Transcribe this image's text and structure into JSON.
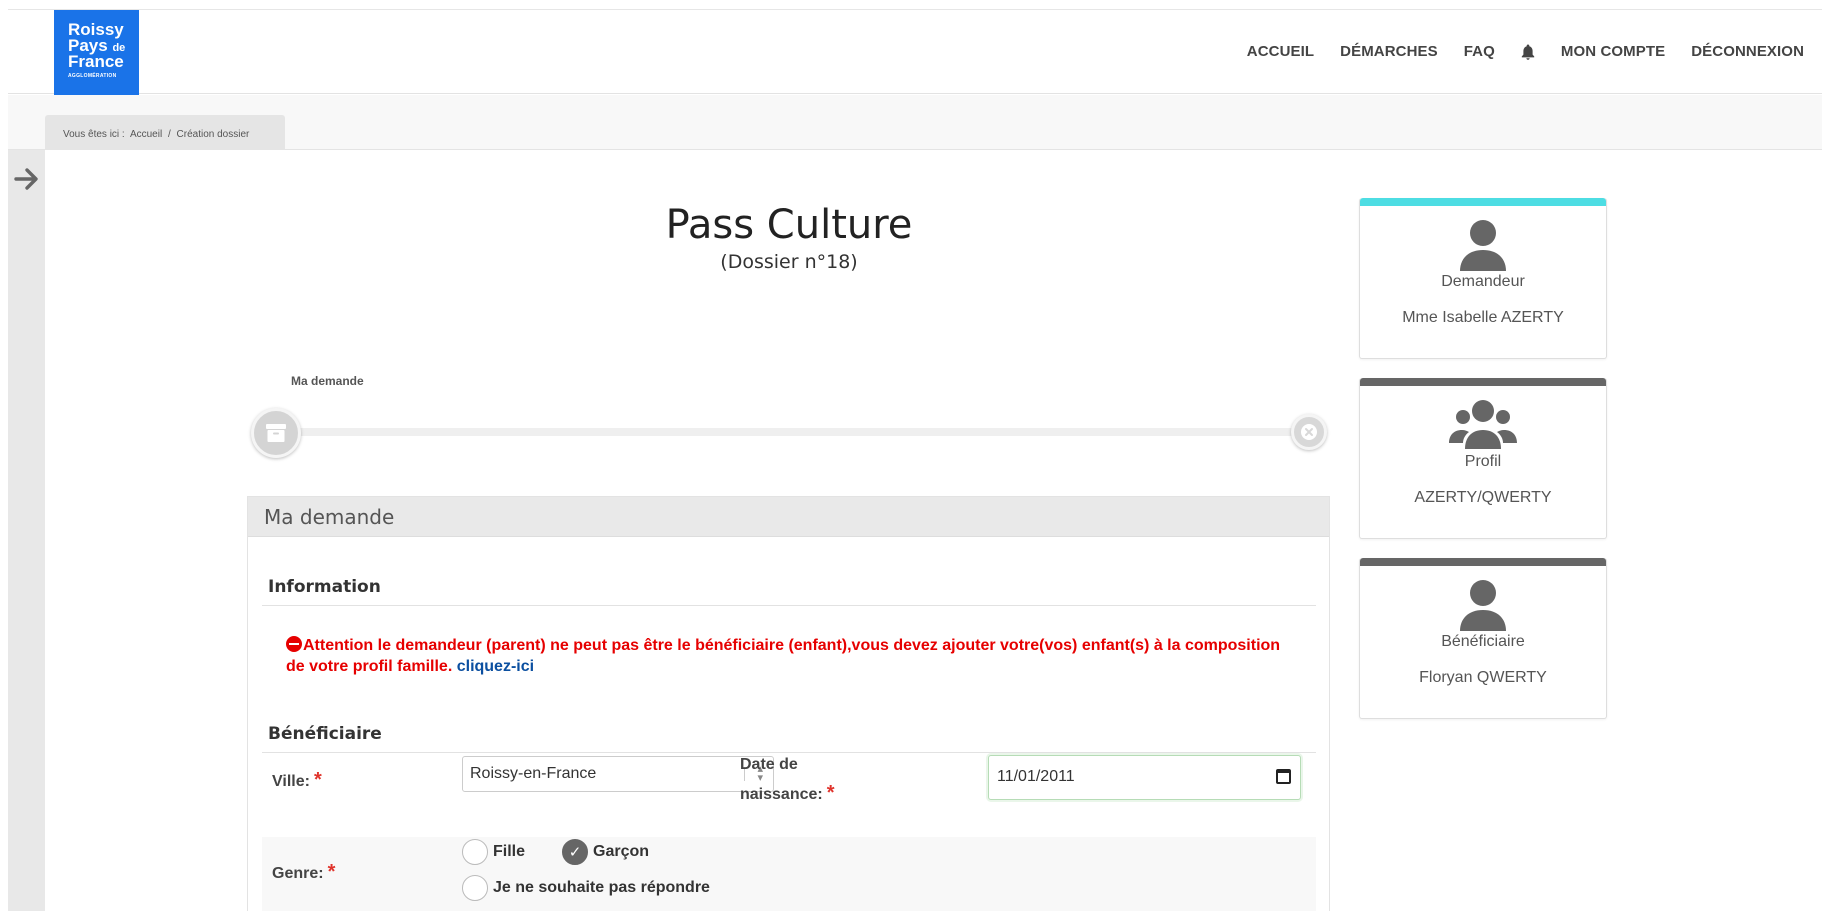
{
  "logo": {
    "line1": "Roissy",
    "line2": "Pays",
    "line2_small": "de",
    "line3": "France",
    "line4": "AGGLOMÉRATION"
  },
  "nav": {
    "items": [
      "ACCUEIL",
      "DÉMARCHES",
      "FAQ",
      "MON COMPTE",
      "DÉCONNEXION"
    ],
    "bell_icon": "bell-icon"
  },
  "breadcrumb": {
    "prefix": "Vous êtes ici :",
    "items": [
      "Accueil",
      "/",
      "Création dossier"
    ]
  },
  "page": {
    "title": "Pass Culture",
    "subtitle": "(Dossier n°18)"
  },
  "stepper": {
    "label": "Ma demande",
    "start_icon": "archive-box-icon",
    "end_icon": "close-circle-icon"
  },
  "form": {
    "panel_title": "Ma demande",
    "section_information": "Information",
    "alert_text": "Attention le demandeur (parent) ne peut pas être le bénéficiaire (enfant),vous devez ajouter votre(vos) enfant(s) à la composition de votre profil famille.",
    "alert_link": "cliquez-ici",
    "section_beneficiaire": "Bénéficiaire",
    "ville_label": "Ville:",
    "ville_value": "Roissy-en-France",
    "date_label_1": "Date de",
    "date_label_2": "naissance:",
    "date_value": "11/01/2011",
    "genre_label": "Genre:",
    "required_mark": "*",
    "genre_options": [
      "Fille",
      "Garçon",
      "Je ne souhaite pas répondre"
    ],
    "genre_selected": "Garçon",
    "check_glyph": "✓"
  },
  "cards": [
    {
      "role": "Demandeur",
      "value": "Mme Isabelle AZERTY",
      "icon": "user-icon",
      "accent": "#4ddde3"
    },
    {
      "role": "Profil",
      "value": "AZERTY/QWERTY",
      "icon": "users-group-icon",
      "accent": "#666666"
    },
    {
      "role": "Bénéficiaire",
      "value": "Floryan QWERTY",
      "icon": "user-icon",
      "accent": "#666666"
    }
  ],
  "colors": {
    "brand_blue": "#1a73e8",
    "alert_red": "#e60000",
    "link_blue": "#0b4fa0"
  }
}
